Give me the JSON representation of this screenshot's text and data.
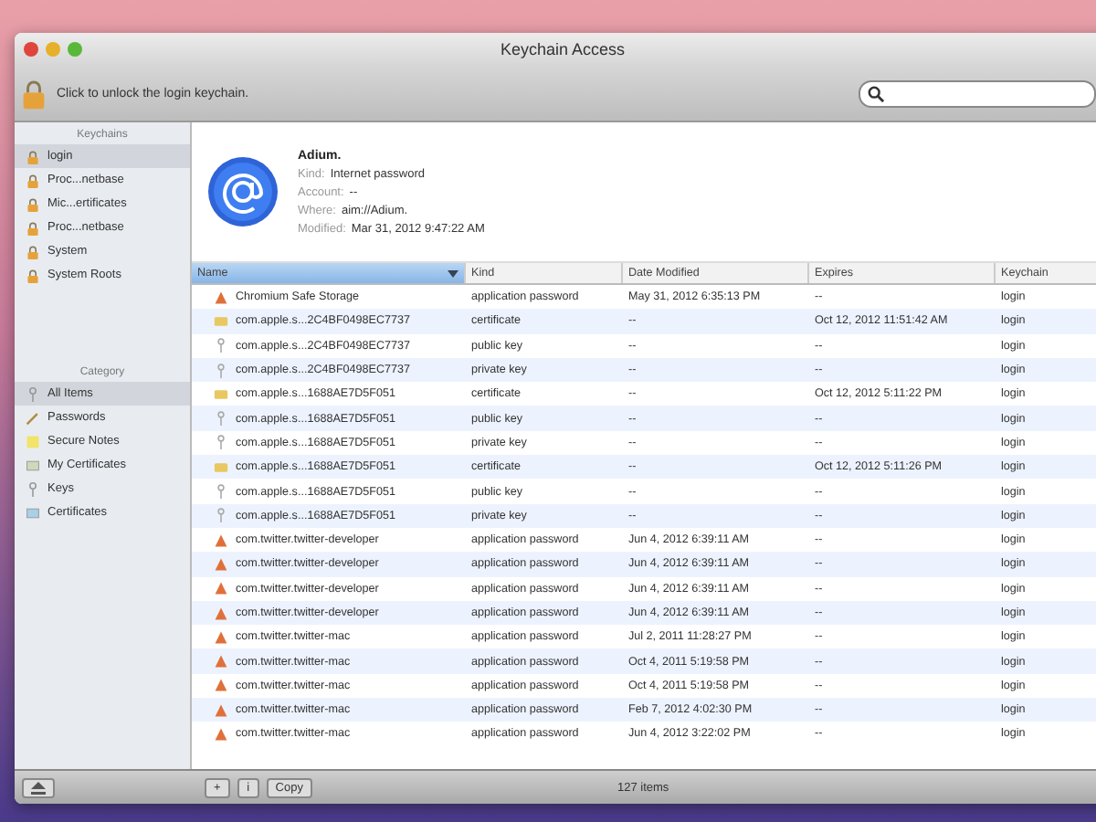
{
  "window": {
    "title": "Keychain Access"
  },
  "toolbar": {
    "lock_message": "Click to unlock the login keychain."
  },
  "sidebar": {
    "keychains_heading": "Keychains",
    "keychains": [
      {
        "label": "login",
        "selected": true
      },
      {
        "label": "Proc...netbase",
        "selected": false
      },
      {
        "label": "Mic...ertificates",
        "selected": false
      },
      {
        "label": "Proc...netbase",
        "selected": false
      },
      {
        "label": "System",
        "selected": false
      },
      {
        "label": "System Roots",
        "selected": false
      }
    ],
    "category_heading": "Category",
    "categories": [
      {
        "label": "All Items",
        "kind": "all",
        "selected": true
      },
      {
        "label": "Passwords",
        "kind": "password",
        "selected": false
      },
      {
        "label": "Secure Notes",
        "kind": "note",
        "selected": false
      },
      {
        "label": "My Certificates",
        "kind": "mycert",
        "selected": false
      },
      {
        "label": "Keys",
        "kind": "key",
        "selected": false
      },
      {
        "label": "Certificates",
        "kind": "cert",
        "selected": false
      }
    ]
  },
  "info": {
    "name": "Adium.",
    "fields": [
      {
        "label": "Kind:",
        "value": "Internet password"
      },
      {
        "label": "Account:",
        "value": "--"
      },
      {
        "label": "Where:",
        "value": "aim://Adium."
      },
      {
        "label": "Modified:",
        "value": "Mar 31, 2012 9:47:22 AM"
      }
    ]
  },
  "table": {
    "columns": [
      {
        "label": "Name",
        "selected": true
      },
      {
        "label": "Kind",
        "selected": false
      },
      {
        "label": "Date Modified",
        "selected": false
      },
      {
        "label": "Expires",
        "selected": false
      },
      {
        "label": "Keychain",
        "selected": false
      }
    ],
    "rows": [
      {
        "kind": "password",
        "cells": [
          "Chromium Safe Storage",
          "application password",
          "May 31, 2012 6:35:13 PM",
          "--",
          "login"
        ]
      },
      {
        "kind": "cert",
        "cells": [
          "com.apple.s...2C4BF0498EC7737",
          "certificate",
          "--",
          "Oct 12, 2012 11:51:42 AM",
          "login"
        ]
      },
      {
        "kind": "key",
        "cells": [
          "com.apple.s...2C4BF0498EC7737",
          "public key",
          "--",
          "--",
          "login"
        ]
      },
      {
        "kind": "key",
        "cells": [
          "com.apple.s...2C4BF0498EC7737",
          "private key",
          "--",
          "--",
          "login"
        ]
      },
      {
        "kind": "cert",
        "cells": [
          "com.apple.s...1688AE7D5F051",
          "certificate",
          "--",
          "Oct 12, 2012 5:11:22 PM",
          "login"
        ]
      },
      {
        "kind": "key",
        "cells": [
          "com.apple.s...1688AE7D5F051",
          "public key",
          "--",
          "--",
          "login"
        ]
      },
      {
        "kind": "key",
        "cells": [
          "com.apple.s...1688AE7D5F051",
          "private key",
          "--",
          "--",
          "login"
        ]
      },
      {
        "kind": "cert",
        "cells": [
          "com.apple.s...1688AE7D5F051",
          "certificate",
          "--",
          "Oct 12, 2012 5:11:26 PM",
          "login"
        ]
      },
      {
        "kind": "key",
        "cells": [
          "com.apple.s...1688AE7D5F051",
          "public key",
          "--",
          "--",
          "login"
        ]
      },
      {
        "kind": "key",
        "cells": [
          "com.apple.s...1688AE7D5F051",
          "private key",
          "--",
          "--",
          "login"
        ]
      },
      {
        "kind": "password",
        "cells": [
          "com.twitter.twitter-developer",
          "application password",
          "Jun 4, 2012 6:39:11 AM",
          "--",
          "login"
        ]
      },
      {
        "kind": "password",
        "cells": [
          "com.twitter.twitter-developer",
          "application password",
          "Jun 4, 2012 6:39:11 AM",
          "--",
          "login"
        ]
      },
      {
        "kind": "password",
        "cells": [
          "com.twitter.twitter-developer",
          "application password",
          "Jun 4, 2012 6:39:11 AM",
          "--",
          "login"
        ]
      },
      {
        "kind": "password",
        "cells": [
          "com.twitter.twitter-developer",
          "application password",
          "Jun 4, 2012 6:39:11 AM",
          "--",
          "login"
        ]
      },
      {
        "kind": "password",
        "cells": [
          "com.twitter.twitter-mac",
          "application password",
          "Jul 2, 2011 11:28:27 PM",
          "--",
          "login"
        ]
      },
      {
        "kind": "password",
        "cells": [
          "com.twitter.twitter-mac",
          "application password",
          "Oct 4, 2011 5:19:58 PM",
          "--",
          "login"
        ]
      },
      {
        "kind": "password",
        "cells": [
          "com.twitter.twitter-mac",
          "application password",
          "Oct 4, 2011 5:19:58 PM",
          "--",
          "login"
        ]
      },
      {
        "kind": "password",
        "cells": [
          "com.twitter.twitter-mac",
          "application password",
          "Feb 7, 2012 4:02:30 PM",
          "--",
          "login"
        ]
      },
      {
        "kind": "password",
        "cells": [
          "com.twitter.twitter-mac",
          "application password",
          "Jun 4, 2012 3:22:02 PM",
          "--",
          "login"
        ]
      }
    ]
  },
  "status_bar": {
    "buttons": [
      "+",
      "i",
      "Copy"
    ],
    "count": "127 items"
  }
}
